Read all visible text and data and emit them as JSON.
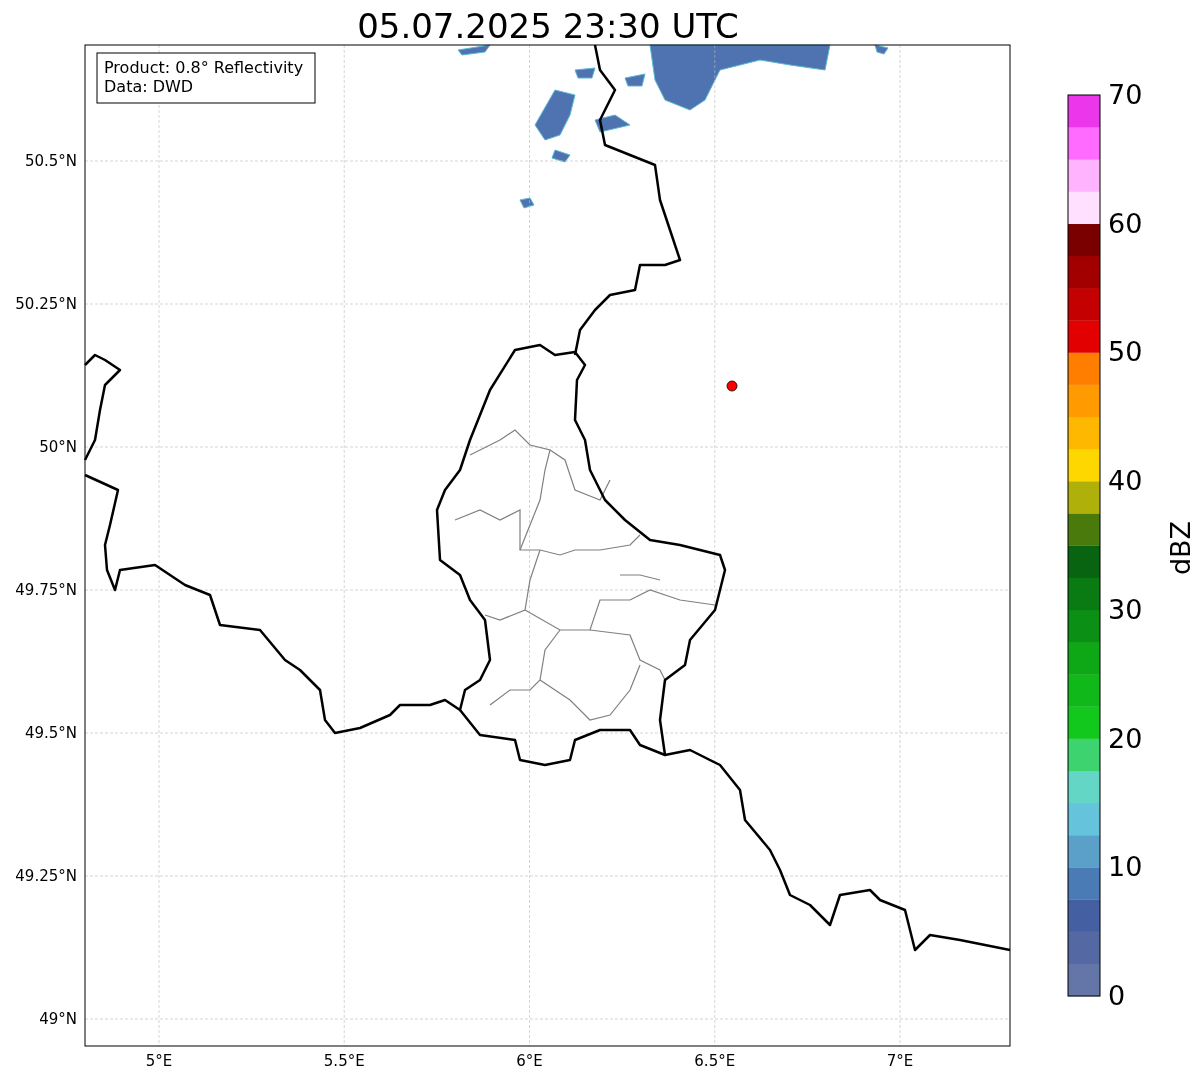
{
  "title": "05.07.2025 23:30 UTC",
  "map": {
    "info_box": [
      "Product: 0.8° Reflectivity",
      "Data: DWD"
    ],
    "lat_ticks": [
      "50.5°N",
      "50.25°N",
      "50°N",
      "49.75°N",
      "49.5°N",
      "49.25°N",
      "49°N"
    ],
    "lon_ticks": [
      "5°E",
      "5.5°E",
      "6°E",
      "6.5°E",
      "7°E"
    ]
  },
  "colorbar": {
    "label": "dBZ",
    "ticks": [
      "70",
      "60",
      "50",
      "40",
      "30",
      "20",
      "10",
      "0"
    ],
    "segments": [
      {
        "color": "#6475a8"
      },
      {
        "color": "#5469a3"
      },
      {
        "color": "#4460a3"
      },
      {
        "color": "#4a7bb5"
      },
      {
        "color": "#5aa0c8"
      },
      {
        "color": "#66c3dc"
      },
      {
        "color": "#63d6c6"
      },
      {
        "color": "#3dd46f"
      },
      {
        "color": "#12c81d"
      },
      {
        "color": "#10b81a"
      },
      {
        "color": "#0ea716"
      },
      {
        "color": "#0b8f14"
      },
      {
        "color": "#0a7a12"
      },
      {
        "color": "#086410"
      },
      {
        "color": "#4a7a0c"
      },
      {
        "color": "#b0b00a"
      },
      {
        "color": "#ffd700"
      },
      {
        "color": "#ffb800"
      },
      {
        "color": "#ff9b00"
      },
      {
        "color": "#ff7e00"
      },
      {
        "color": "#e30000"
      },
      {
        "color": "#c40000"
      },
      {
        "color": "#a20000"
      },
      {
        "color": "#7a0000"
      },
      {
        "color": "#ffe0ff"
      },
      {
        "color": "#ffb3ff"
      },
      {
        "color": "#ff6bff"
      },
      {
        "color": "#eb36eb"
      }
    ]
  }
}
